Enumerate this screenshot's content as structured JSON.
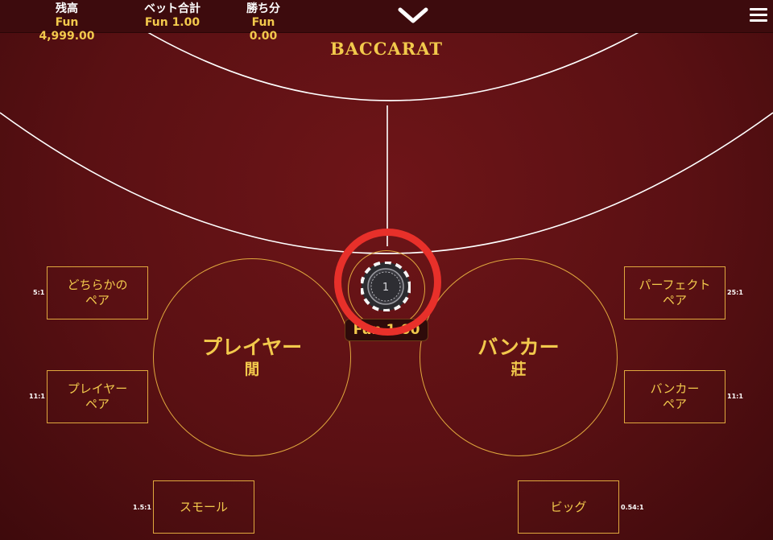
{
  "header": {
    "balance_label": "残高",
    "balance_value": "Fun 4,999.00",
    "total_bet_label": "ベット合計",
    "total_bet_value": "Fun 1.00",
    "win_label": "勝ち分",
    "win_value": "Fun 0.00"
  },
  "table": {
    "brand": "BACCARAT",
    "player_label": "プレイヤー",
    "player_sub": "閒",
    "banker_label": "バンカー",
    "banker_sub": "莊",
    "chip_value": "1",
    "tie_bet_amount": "Fun 1.00"
  },
  "side_bets": {
    "either_pair": {
      "line1": "どちらかの",
      "line2": "ペア",
      "odds": "5:1"
    },
    "player_pair": {
      "line1": "プレイヤー",
      "line2": "ペア",
      "odds": "11:1"
    },
    "small": {
      "label": "スモール",
      "odds": "1.5:1"
    },
    "perfect_pair": {
      "line1": "パーフェクト",
      "line2": "ペア",
      "odds": "25:1"
    },
    "banker_pair": {
      "line1": "バンカー",
      "line2": "ペア",
      "odds": "11:1"
    },
    "big": {
      "label": "ビッグ",
      "odds": "0.54:1"
    }
  },
  "colors": {
    "felt": "#5a1013",
    "gold": "#f2c94c",
    "highlight_ring": "#e8302a"
  }
}
